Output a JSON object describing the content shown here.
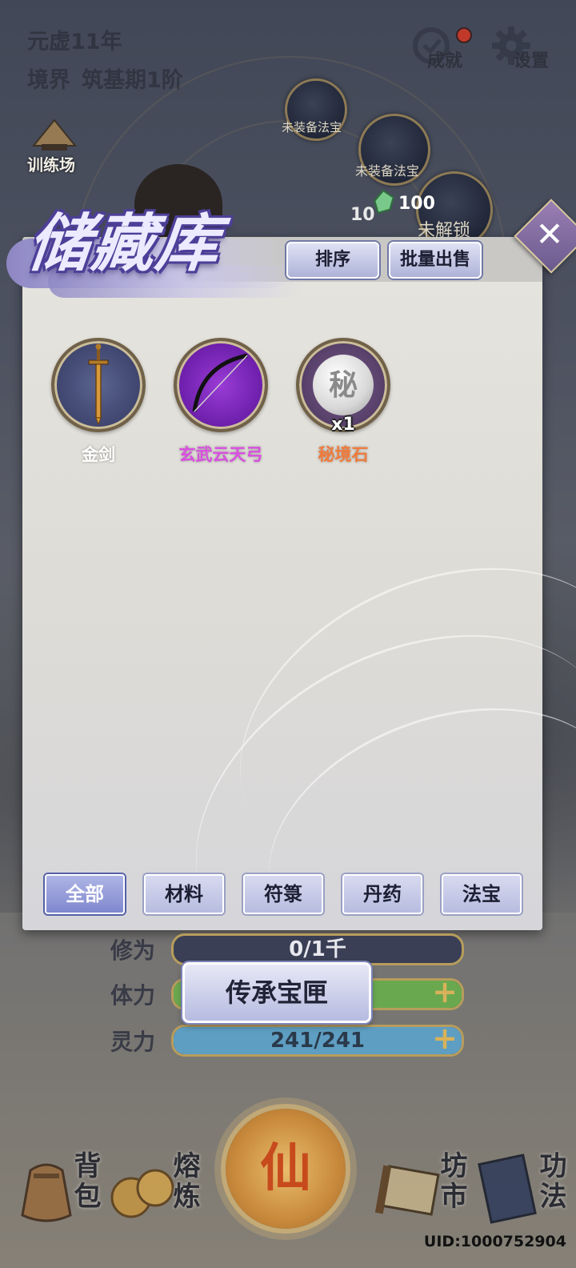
{
  "hud": {
    "year": "元虚11年",
    "realm_label": "境界",
    "realm_value": "筑基期1阶",
    "achievement": "成就",
    "settings": "设置",
    "training": "训练场"
  },
  "slots": {
    "unequipped_1": "未装备法宝",
    "unequipped_2": "未装备法宝",
    "locked": "未解锁",
    "jade_count": "100",
    "gourd_count": "10"
  },
  "dialog": {
    "title": "储藏库",
    "sort_button": "排序",
    "bulk_sell_button": "批量出售",
    "close_symbol": "✕",
    "items": [
      {
        "name": "金剑",
        "name_color": "#ffffff",
        "icon": "gold-sword-icon",
        "count": ""
      },
      {
        "name": "玄武云天弓",
        "name_color": "#d94fe0",
        "icon": "bow-icon",
        "count": ""
      },
      {
        "name": "秘境石",
        "name_color": "#f07a3b",
        "icon": "secret-stone-icon",
        "glyph": "秘",
        "count": "x1"
      }
    ],
    "tabs": [
      {
        "label": "全部",
        "active": true
      },
      {
        "label": "材料",
        "active": false
      },
      {
        "label": "符箓",
        "active": false
      },
      {
        "label": "丹药",
        "active": false
      },
      {
        "label": "法宝",
        "active": false
      }
    ]
  },
  "stats": {
    "cultivation_label": "修为",
    "cultivation_value": "0/1千",
    "stamina_label": "体力",
    "spirit_label": "灵力",
    "spirit_value": "241/241",
    "plus": "+"
  },
  "legacy_button": "传承宝匣",
  "nav": {
    "backpack": "背包",
    "smelt": "熔炼",
    "center": "仙",
    "market": "坊市",
    "skills": "功法"
  },
  "uid": "UID:1000752904",
  "colors": {
    "accent_purple": "#7f88cf",
    "bow_purple": "#d94fe0",
    "stone_orange": "#f07a3b",
    "stamina_green": "#6aa84f",
    "spirit_blue": "#5e9ec2"
  }
}
